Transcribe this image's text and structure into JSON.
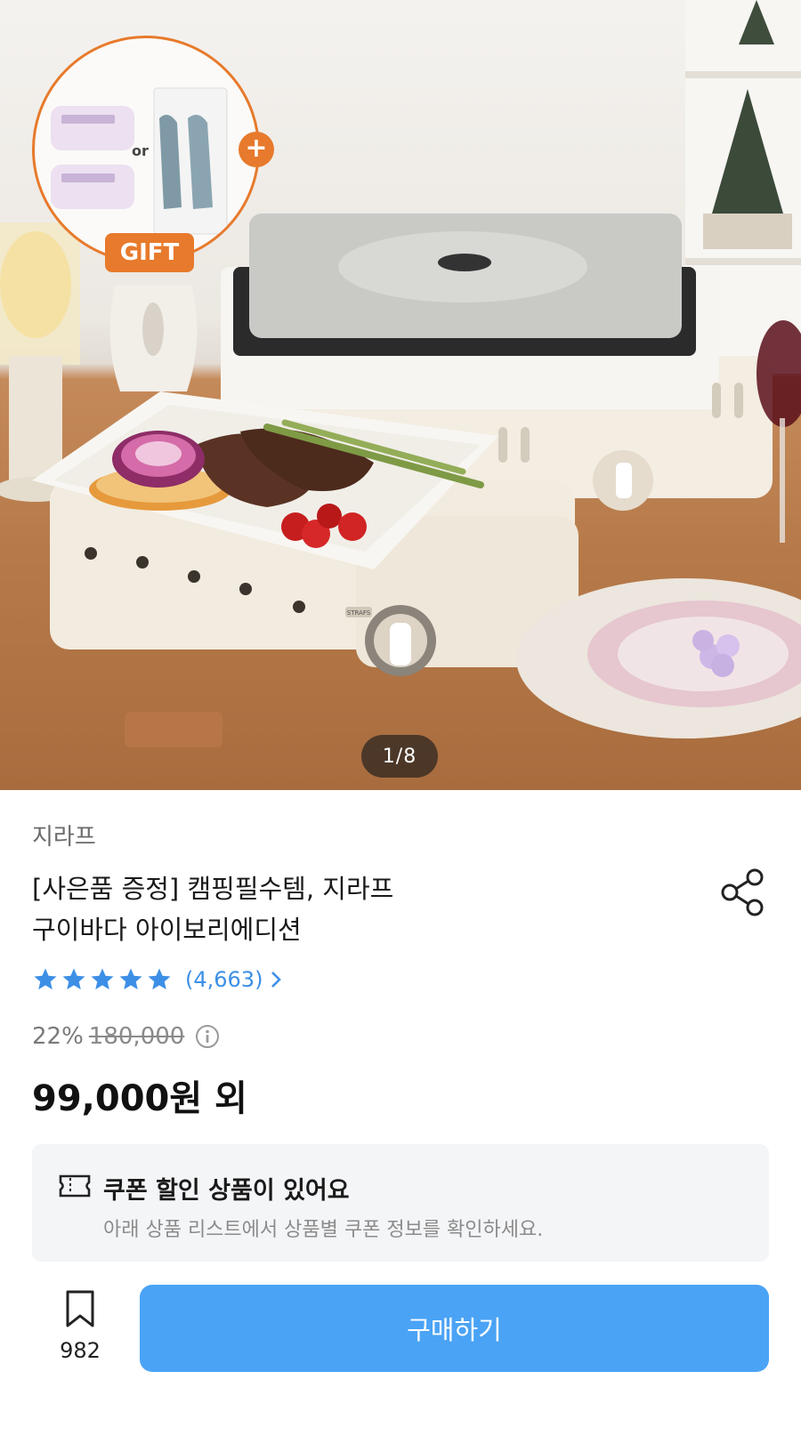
{
  "hero": {
    "gift_or": "or",
    "gift_plus": "+",
    "gift_label": "GIFT",
    "slide_counter": "1/8",
    "stove_brand_mark": "STRAFS"
  },
  "product": {
    "brand": "지라프",
    "title_line1": "[사은품 증정] 캠핑필수템, 지라프",
    "title_line2": "구이바다 아이보리에디션",
    "rating": {
      "stars": 5,
      "max": 5,
      "review_count": "(4,663)"
    },
    "discount_percent": "22%",
    "original_price": "180,000",
    "price": "99,000원 외"
  },
  "coupon": {
    "title": "쿠폰 할인 상품이 있어요",
    "subtitle": "아래 상품 리스트에서 상품별 쿠폰 정보를 확인하세요."
  },
  "bottom_bar": {
    "bookmark_count": "982",
    "buy_label": "구매하기"
  },
  "colors": {
    "accent_blue": "#4aa3f5",
    "star_blue": "#3d8fe6",
    "gift_orange": "#e77a2c"
  },
  "icons": [
    "share-icon",
    "star-icon",
    "chevron-right-icon",
    "info-icon",
    "coupon-icon",
    "bookmark-icon",
    "plus-icon"
  ]
}
